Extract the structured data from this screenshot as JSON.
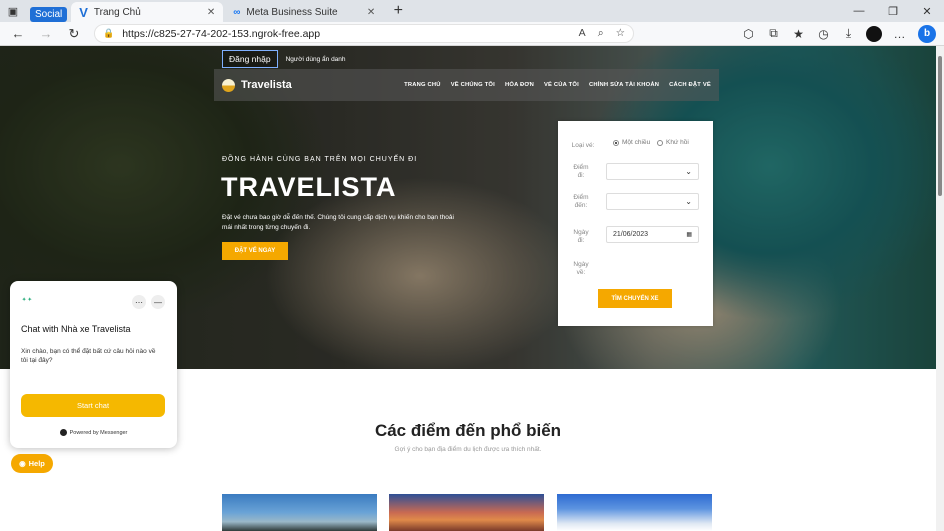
{
  "browser": {
    "social_badge": "Social",
    "tabs": [
      {
        "icon": "v-icon",
        "title": "Trang Chủ",
        "active": true
      },
      {
        "icon": "meta-icon",
        "title": "Meta Business Suite",
        "active": false
      }
    ],
    "url": "https://c825-27-74-202-153.ngrok-free.app",
    "accent": "#1f6fd6"
  },
  "header": {
    "login_label": "Đăng nhập",
    "anon_label": "Người dùng ẩn danh",
    "brand": "Travelista",
    "menu": [
      "TRANG CHỦ",
      "VỀ CHÚNG TÔI",
      "HÓA ĐƠN",
      "VÉ CỦA TÔI",
      "CHỈNH SỬA TÀI KHOẢN",
      "CÁCH ĐẶT VÉ"
    ]
  },
  "hero": {
    "eyebrow": "ĐỒNG HÀNH CÙNG BẠN TRÊN MỌI CHUYẾN ĐI",
    "title": "TRAVELISTA",
    "description": "Đặt vé chưa bao giờ dễ đến thế. Chúng tôi cung cấp dịch vụ khiến cho bạn thoải mái nhất trong từng chuyến đi.",
    "cta": "ĐẶT VÉ NGAY"
  },
  "booking": {
    "ticket_type_label": "Loại vé:",
    "one_way": "Một chiều",
    "round_trip": "Khứ hồi",
    "from_label": "Điểm đi:",
    "to_label": "Điểm đến:",
    "depart_label": "Ngày đi:",
    "depart_value": "21/06/2023",
    "return_label": "Ngày về:",
    "search_button": "TÌM CHUYẾN XE"
  },
  "section": {
    "title": "Các điểm đến phổ biến",
    "subtitle": "Gợi ý cho bạn địa điểm du lịch được ưa thích nhất."
  },
  "chat": {
    "title": "Chat with Nhà xe Travelista",
    "message": "Xin chào, bạn có thể đặt bất cứ câu hỏi nào về tôi tại đây?",
    "start": "Start chat",
    "powered": "Powered by Messenger",
    "help": "Help"
  },
  "colors": {
    "primary": "#f5a800"
  }
}
